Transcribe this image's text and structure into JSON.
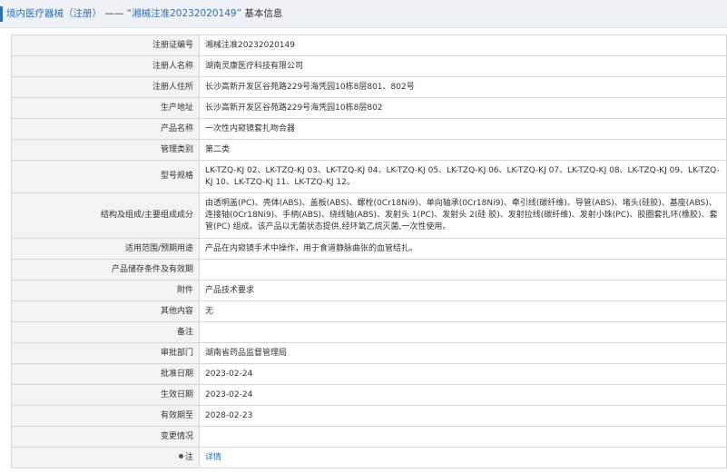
{
  "header": {
    "category": "境内医疗器械（注册）",
    "separator": " —— ",
    "reg_title": "“湘械注准20232020149”",
    "suffix": " 基本信息"
  },
  "rows": [
    {
      "label": "注册证编号",
      "value": "湘械注准20232020149"
    },
    {
      "label": "注册人名称",
      "value": "湖南灵康医疗科技有限公司"
    },
    {
      "label": "注册人住所",
      "value": "长沙高新开发区谷苑路229号海凭园10栋8层801、802号"
    },
    {
      "label": "生产地址",
      "value": "长沙高新开发区谷苑路229号海凭园10栋8层802"
    },
    {
      "label": "产品名称",
      "value": "一次性内窥镜套扎吻合器"
    },
    {
      "label": "管理类别",
      "value": "第二类"
    },
    {
      "label": "型号规格",
      "value": "LK-TZQ-KJ 02、LK-TZQ-KJ 03、LK-TZQ-KJ 04、LK-TZQ-KJ 05、LK-TZQ-KJ 06、LK-TZQ-KJ 07、LK-TZQ-KJ 08、LK-TZQ-KJ 09、LK-TZQ-KJ 10、LK-TZQ-KJ 11、LK-TZQ-KJ 12。"
    },
    {
      "label": "结构及组成/主要组成成分",
      "value": "由透明盖(PC)、壳体(ABS)、盖板(ABS)、螺栓(0Cr18Ni9)、单向轴承(0Cr18Ni9)、牵引线(碳纤维)、导管(ABS)、堵头(硅胶)、基座(ABS)、连接轴(0Cr18Ni9)、手柄(ABS)、绕线轴(ABS)、发射头 1(PC)、发射头 2(硅 胶)、发射拉线(碳纤维)、发射小珠(PC)、胶圈套扎环(橡胶)、套管(PC) 组成。该产品以无菌状态提供,经环氧乙烷灭菌,一次性使用。"
    },
    {
      "label": "适用范围/预期用途",
      "value": "产品在内窥镜手术中操作，用于食道静脉曲张的血管结扎。"
    },
    {
      "label": "产品储存条件及有效期",
      "value": ""
    },
    {
      "label": "附件",
      "value": "产品技术要求"
    },
    {
      "label": "其他内容",
      "value": "无"
    },
    {
      "label": "备注",
      "value": ""
    },
    {
      "label": "审批部门",
      "value": "湖南省药品监督管理局"
    },
    {
      "label": "批准日期",
      "value": "2023-02-24"
    },
    {
      "label": "生效日期",
      "value": "2023-02-24"
    },
    {
      "label": "有效期至",
      "value": "2028-02-23"
    },
    {
      "label": "变更情况",
      "value": ""
    },
    {
      "label": "注",
      "value": "详情"
    }
  ]
}
